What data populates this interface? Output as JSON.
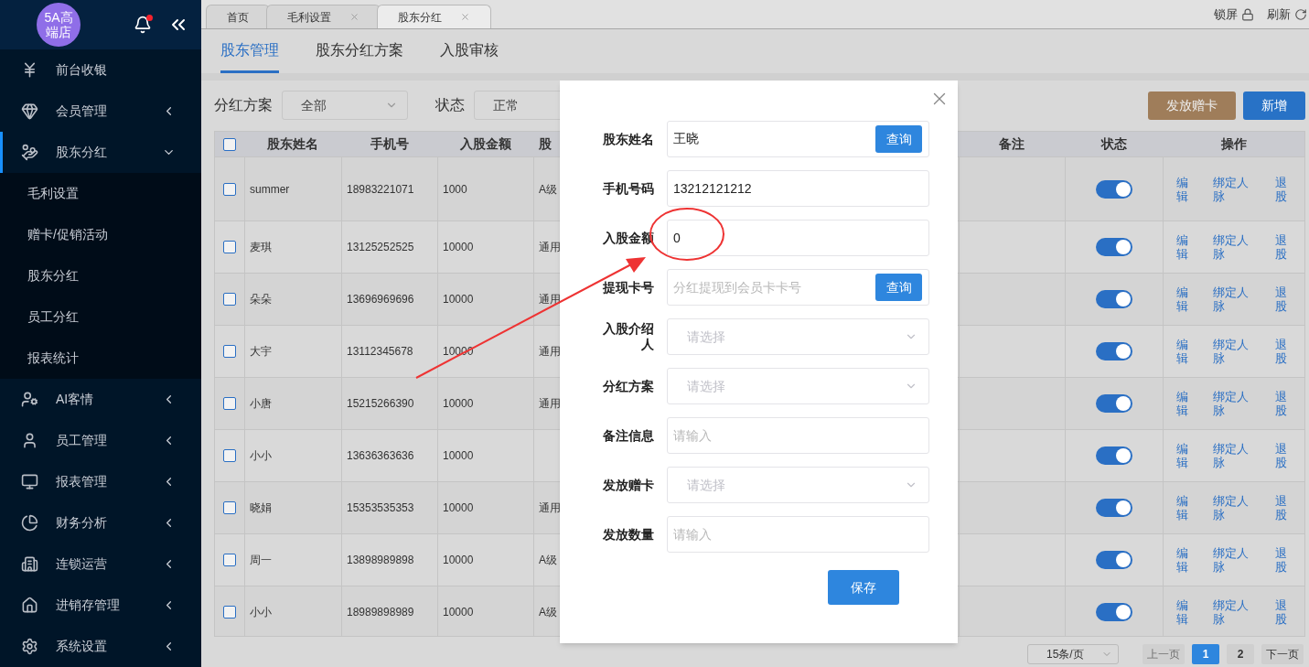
{
  "sidebar": {
    "logo": "5A高端店",
    "notification": true,
    "items": [
      {
        "label": "前台收银",
        "kind": "link",
        "selected": false
      },
      {
        "label": "会员管理",
        "kind": "group",
        "selected": false,
        "expanded": false
      },
      {
        "label": "股东分红",
        "kind": "group",
        "selected": true,
        "expanded": true,
        "children": [
          {
            "label": "毛利设置"
          },
          {
            "label": "赠卡/促销活动"
          },
          {
            "label": "股东分红"
          },
          {
            "label": "员工分红"
          },
          {
            "label": "报表统计"
          }
        ]
      },
      {
        "label": "AI客情",
        "kind": "group",
        "selected": false,
        "expanded": false
      },
      {
        "label": "员工管理",
        "kind": "group",
        "selected": false,
        "expanded": false
      },
      {
        "label": "报表管理",
        "kind": "group",
        "selected": false,
        "expanded": false
      },
      {
        "label": "财务分析",
        "kind": "group",
        "selected": false,
        "expanded": false
      },
      {
        "label": "连锁运营",
        "kind": "group",
        "selected": false,
        "expanded": false
      },
      {
        "label": "进销存管理",
        "kind": "group",
        "selected": false,
        "expanded": false
      },
      {
        "label": "系统设置",
        "kind": "group",
        "selected": false,
        "expanded": false
      }
    ]
  },
  "page_tabs": [
    {
      "label": "首页",
      "selected": false,
      "closable": false
    },
    {
      "label": "毛利设置",
      "selected": false,
      "closable": true
    },
    {
      "label": "股东分红",
      "selected": true,
      "closable": true
    }
  ],
  "header_actions": [
    {
      "label": "锁屏"
    },
    {
      "label": "刷新"
    }
  ],
  "sub_tabs": [
    {
      "label": "股东管理",
      "selected": true
    },
    {
      "label": "股东分红方案",
      "selected": false
    },
    {
      "label": "入股审核",
      "selected": false
    }
  ],
  "filters": [
    {
      "label": "分红方案",
      "value": "全部"
    },
    {
      "label": "状态",
      "value": "正常"
    }
  ],
  "toolbar_buttons": [
    {
      "label": "发放赠卡",
      "kind": "secondary"
    },
    {
      "label": "新增",
      "kind": "primary"
    }
  ],
  "table": {
    "all_checked": false,
    "columns": [
      "股东姓名",
      "手机号",
      "入股金额",
      "股",
      "备注",
      "状态",
      "操作"
    ],
    "rows": [
      {
        "checked": false,
        "cells": [
          "summer",
          "18983221071",
          "1000",
          "A级"
        ],
        "status_on": true,
        "actions": [
          "编辑",
          "绑定人脉",
          "退股"
        ]
      },
      {
        "checked": false,
        "cells": [
          "麦琪",
          "13125252525",
          "10000",
          "通用"
        ],
        "status_on": true,
        "actions": [
          "编辑",
          "绑定人脉",
          "退股"
        ]
      },
      {
        "checked": false,
        "cells": [
          "朵朵",
          "13696969696",
          "10000",
          "通用"
        ],
        "status_on": true,
        "actions": [
          "编辑",
          "绑定人脉",
          "退股"
        ]
      },
      {
        "checked": false,
        "cells": [
          "大宇",
          "13112345678",
          "10000",
          "通用"
        ],
        "status_on": true,
        "actions": [
          "编辑",
          "绑定人脉",
          "退股"
        ]
      },
      {
        "checked": false,
        "cells": [
          "小唐",
          "15215266390",
          "10000",
          "通用"
        ],
        "status_on": true,
        "actions": [
          "编辑",
          "绑定人脉",
          "退股"
        ]
      },
      {
        "checked": false,
        "cells": [
          "小小",
          "13636363636",
          "10000"
        ],
        "status_on": true,
        "actions": [
          "编辑",
          "绑定人脉",
          "退股"
        ]
      },
      {
        "checked": false,
        "cells": [
          "晓娟",
          "15353535353",
          "10000",
          "通用"
        ],
        "status_on": true,
        "actions": [
          "编辑",
          "绑定人脉",
          "退股"
        ]
      },
      {
        "checked": false,
        "cells": [
          "周一",
          "13898989898",
          "10000",
          "A级"
        ],
        "status_on": true,
        "actions": [
          "编辑",
          "绑定人脉",
          "退股"
        ]
      },
      {
        "checked": false,
        "cells": [
          "小小",
          "18989898989",
          "10000",
          "A级"
        ],
        "status_on": true,
        "actions": [
          "编辑",
          "绑定人脉",
          "退股"
        ]
      }
    ]
  },
  "pagination": {
    "page_size": "15条/页",
    "prev": "上一页",
    "prev_disabled": true,
    "pages": [
      {
        "label": "1",
        "selected": true
      },
      {
        "label": "2",
        "selected": false
      }
    ],
    "next": "下一页"
  },
  "modal": {
    "fields": [
      {
        "label": "股东姓名",
        "kind": "input",
        "value": "王晓",
        "button": "查询"
      },
      {
        "label": "手机号码",
        "kind": "input",
        "value": "13212121212"
      },
      {
        "label": "入股金额",
        "kind": "input",
        "value": "0"
      },
      {
        "label": "提现卡号",
        "kind": "input",
        "placeholder": "分红提现到会员卡卡号",
        "button": "查询"
      },
      {
        "label": "入股介绍人",
        "kind": "select",
        "placeholder": "请选择"
      },
      {
        "label": "分红方案",
        "kind": "select",
        "placeholder": "请选择"
      },
      {
        "label": "备注信息",
        "kind": "input",
        "placeholder": "请输入"
      },
      {
        "label": "发放赠卡",
        "kind": "select",
        "placeholder": "请选择"
      },
      {
        "label": "发放数量",
        "kind": "input",
        "placeholder": "请输入"
      }
    ],
    "save": "保存"
  }
}
